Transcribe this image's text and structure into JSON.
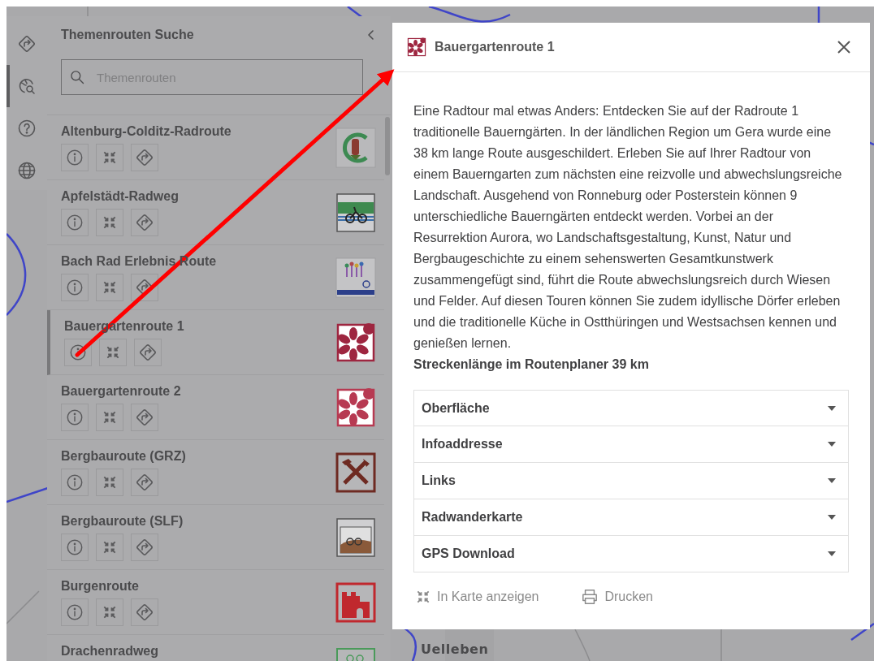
{
  "map": {
    "labels": [
      "Uelleben"
    ]
  },
  "rail": [
    {
      "kind": "route",
      "selected": false
    },
    {
      "kind": "globe-search",
      "selected": true
    },
    {
      "kind": "help",
      "selected": false
    },
    {
      "kind": "globe",
      "selected": false
    }
  ],
  "panel": {
    "title": "Themenrouten Suche",
    "search": {
      "placeholder": "Themenrouten"
    }
  },
  "routes": [
    {
      "name": "Altenburg-Colditz-Radroute",
      "selected": false
    },
    {
      "name": "Apfelstädt-Radweg",
      "selected": false
    },
    {
      "name": "Bach Rad Erlebnis Route",
      "selected": false
    },
    {
      "name": "Bauergartenroute 1",
      "selected": true
    },
    {
      "name": "Bauergartenroute 2",
      "selected": false
    },
    {
      "name": "Bergbauroute (GRZ)",
      "selected": false
    },
    {
      "name": "Bergbauroute (SLF)",
      "selected": false
    },
    {
      "name": "Burgenroute",
      "selected": false
    },
    {
      "name": "Drachenradweg",
      "selected": false
    }
  ],
  "dialog": {
    "title": "Bauergartenroute 1",
    "description": "Eine Radtour mal etwas Anders: Entdecken Sie auf der Radroute 1 traditionelle Bauerngärten. In der ländlichen Region um Gera wurde eine 38 km lange Route ausgeschildert. Erleben Sie auf Ihrer Radtour von einem Bauerngarten zum nächsten eine reizvolle und abwechslungsreiche Landschaft. Ausgehend von Ronneburg oder Posterstein können 9 unterschiedliche Bauerngärten entdeckt werden. Vorbei an der Resurrektion Aurora, wo Landschaftsgestaltung, Kunst, Natur und Bergbaugeschichte zu einem sehenswerten Gesamtkunstwerk zusammengefügt sind, führt die Route abwechslungsreich durch Wiesen und Felder. Auf diesen Touren können Sie zudem idyllische Dörfer erleben und die traditionelle Küche in Ostthüringen und Westsachsen kennen und genießen lernen.",
    "route_length": "Streckenlänge im Routenplaner 39 km",
    "sections": [
      {
        "label": "Oberfläche",
        "expanded": false
      },
      {
        "label": "Infoaddresse",
        "expanded": false
      },
      {
        "label": "Links",
        "expanded": false
      },
      {
        "label": "Radwanderkarte",
        "expanded": false
      },
      {
        "label": "GPS Download",
        "expanded": false
      }
    ],
    "actions": [
      {
        "kind": "show-on-map",
        "label": "In Karte anzeigen"
      },
      {
        "kind": "print",
        "label": "Drucken"
      }
    ]
  }
}
